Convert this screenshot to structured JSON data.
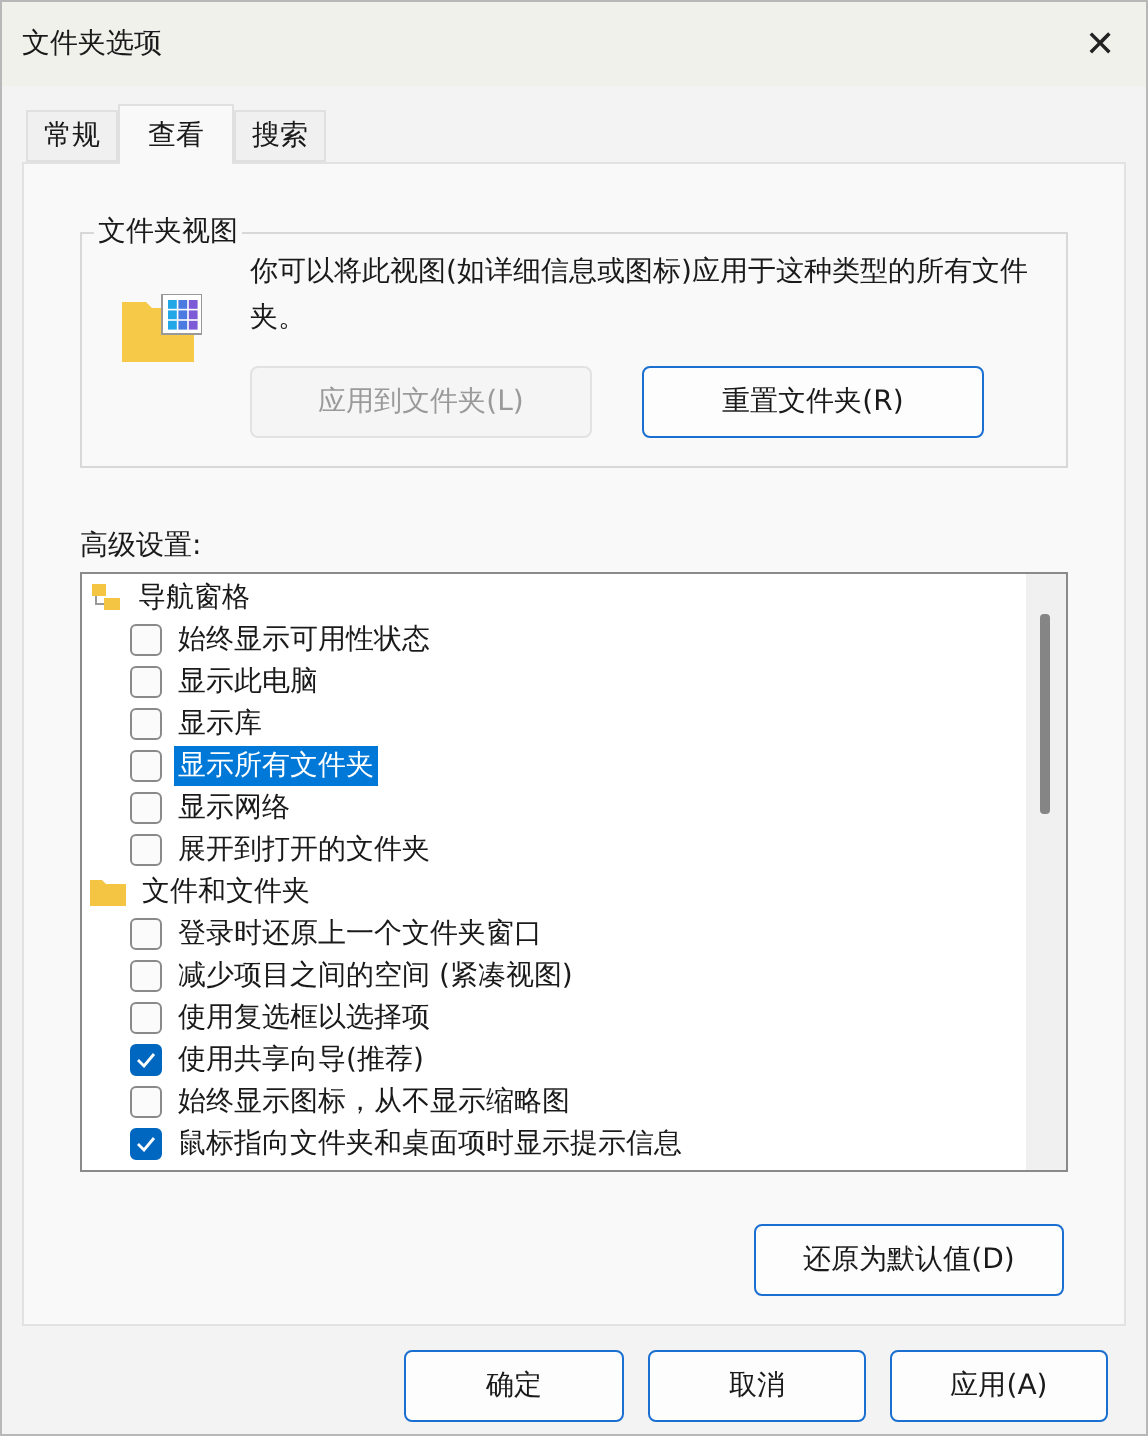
{
  "window": {
    "title": "文件夹选项",
    "close": "✕"
  },
  "tabs": [
    {
      "label": "常规",
      "selected": false
    },
    {
      "label": "查看",
      "selected": true
    },
    {
      "label": "搜索",
      "selected": false
    }
  ],
  "folder_views": {
    "title": "文件夹视图",
    "description": "你可以将此视图(如详细信息或图标)应用于这种类型的所有文件夹。",
    "buttons": [
      {
        "label": "应用到文件夹(L)",
        "disabled": true
      },
      {
        "label": "重置文件夹(R)",
        "disabled": false
      }
    ]
  },
  "advanced": {
    "label": "高级设置:",
    "tree": [
      {
        "label": "导航窗格",
        "kind": "pane",
        "children": [
          {
            "label": "始终显示可用性状态",
            "checked": false,
            "selected": false
          },
          {
            "label": "显示此电脑",
            "checked": false,
            "selected": false
          },
          {
            "label": "显示库",
            "checked": false,
            "selected": false
          },
          {
            "label": "显示所有文件夹",
            "checked": false,
            "selected": true
          },
          {
            "label": "显示网络",
            "checked": false,
            "selected": false
          },
          {
            "label": "展开到打开的文件夹",
            "checked": false,
            "selected": false
          }
        ]
      },
      {
        "label": "文件和文件夹",
        "kind": "folder",
        "children": [
          {
            "label": "登录时还原上一个文件夹窗口",
            "checked": false,
            "selected": false
          },
          {
            "label": "减少项目之间的空间 (紧凑视图)",
            "checked": false,
            "selected": false
          },
          {
            "label": "使用复选框以选择项",
            "checked": false,
            "selected": false
          },
          {
            "label": "使用共享向导(推荐)",
            "checked": true,
            "selected": false
          },
          {
            "label": "始终显示图标，从不显示缩略图",
            "checked": false,
            "selected": false
          },
          {
            "label": "鼠标指向文件夹和桌面项时显示提示信息",
            "checked": true,
            "selected": false
          }
        ]
      }
    ]
  },
  "restore_button": "还原为默认值(D)",
  "buttons": [
    "确定",
    "取消",
    "应用(A)"
  ]
}
